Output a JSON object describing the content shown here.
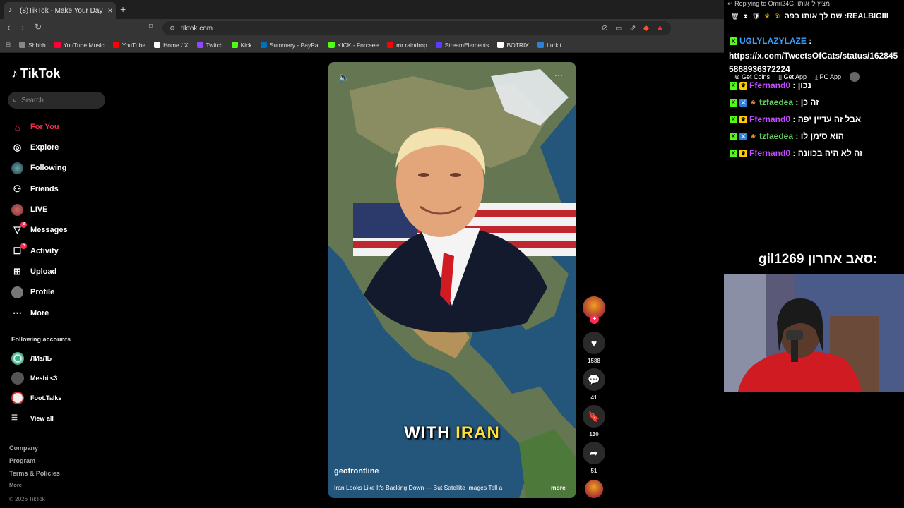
{
  "browser": {
    "tab_title": "(8)TikTok - Make Your Day",
    "url": "tiktok.com",
    "bookmarks": [
      {
        "label": "Shhhh",
        "color": "#888888"
      },
      {
        "label": "YouTube Music",
        "color": "#ff0033"
      },
      {
        "label": "YouTube",
        "color": "#ff0000"
      },
      {
        "label": "Home / X",
        "color": "#ffffff"
      },
      {
        "label": "Twitch",
        "color": "#9146ff"
      },
      {
        "label": "Kick",
        "color": "#53fc18"
      },
      {
        "label": "Summary - PayPal",
        "color": "#0070ba"
      },
      {
        "label": "KICK - Forceee",
        "color": "#53fc18"
      },
      {
        "label": "mr raindrop",
        "color": "#ff0000"
      },
      {
        "label": "StreamElements",
        "color": "#5c3bff"
      },
      {
        "label": "BOTRIX",
        "color": "#ffffff"
      },
      {
        "label": "Lurkit",
        "color": "#2f7fd8"
      }
    ]
  },
  "tiktok": {
    "logo": "TikTok",
    "search_placeholder": "Search",
    "nav": [
      {
        "label": "For You",
        "icon": "home-icon",
        "active": true
      },
      {
        "label": "Explore",
        "icon": "compass-icon"
      },
      {
        "label": "Following",
        "icon": "following-avatar-icon"
      },
      {
        "label": "Friends",
        "icon": "friends-icon"
      },
      {
        "label": "LIVE",
        "icon": "live-avatar-icon"
      },
      {
        "label": "Messages",
        "icon": "messages-icon",
        "badge": "3"
      },
      {
        "label": "Activity",
        "icon": "activity-icon",
        "badge": "5"
      },
      {
        "label": "Upload",
        "icon": "upload-icon"
      },
      {
        "label": "Profile",
        "icon": "profile-avatar-icon"
      },
      {
        "label": "More",
        "icon": "more-icon"
      }
    ],
    "following_accounts_label": "Following accounts",
    "accounts": [
      "ЛИзЛЬ",
      "Meshi <3",
      "Foot.Talks"
    ],
    "view_all": "View all",
    "footer": [
      "Company",
      "Program",
      "Terms & Policies",
      "More",
      "© 2026 TikTok"
    ],
    "video": {
      "caption_plain": "WITH",
      "caption_highlight": "IRAN",
      "author": "geofrontline",
      "description": "Iran Looks Like It's Backing Down — But Satellite Images Tell a",
      "more": "more"
    },
    "actions": {
      "likes": "1588",
      "comments": "41",
      "saves": "130",
      "shares": "51"
    }
  },
  "stream_overlay": {
    "reply_to": "Replying to Omri24G: מציץ ל' אותו",
    "header_line": "שם לך אותו בפה :REALBIGIII",
    "messages": [
      {
        "user": "UGLYLAZYLAZE",
        "user_color": "#3aa0ff",
        "text": "https://x.com/TweetsOfCats/status/1628455868936372224"
      },
      {
        "user": "Ffernand0",
        "user_color": "#c04bff",
        "text": "נכון"
      },
      {
        "user": "tzfaedea",
        "user_color": "#5fd35f",
        "text": "זה כן"
      },
      {
        "user": "Ffernand0",
        "user_color": "#c04bff",
        "text": "אבל זה עדיין יפה"
      },
      {
        "user": "tzfaedea",
        "user_color": "#5fd35f",
        "text": "הוא סימן לו"
      },
      {
        "user": "Ffernand0",
        "user_color": "#c04bff",
        "text": "זה לא היה בכוונה"
      }
    ],
    "get_coins": "Get Coins",
    "get_app": "Get App",
    "pc_app": "PC App",
    "last_sub_label": "סאב אחרון:",
    "last_sub_user": "gil1269"
  }
}
